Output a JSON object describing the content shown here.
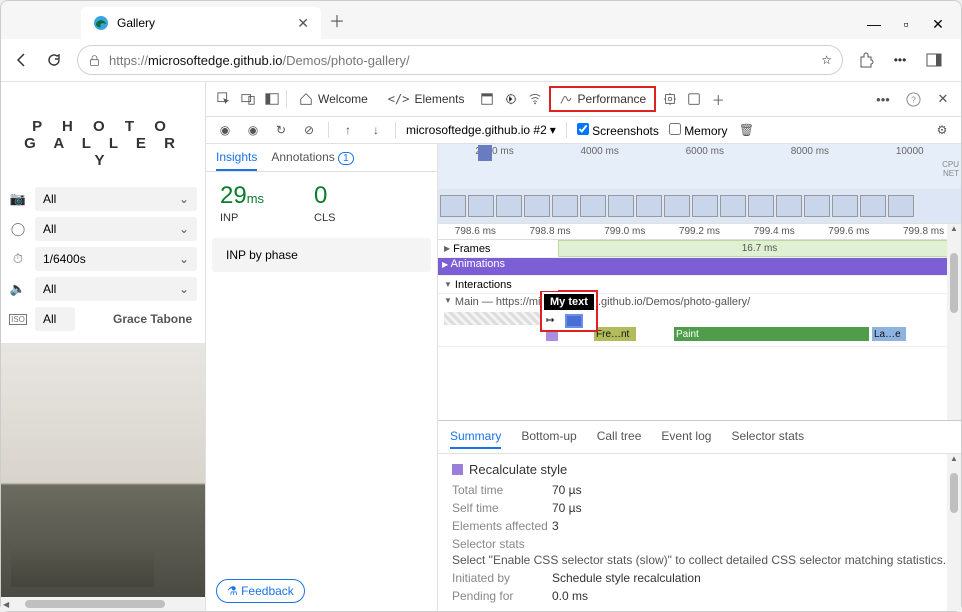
{
  "browser": {
    "tab_title": "Gallery",
    "url_prefix": "https://",
    "url_host": "microsoftedge.github.io",
    "url_path": "/Demos/photo-gallery/"
  },
  "gallery": {
    "logo1": "P H O T O",
    "logo2": "G A L L E R Y",
    "filters": [
      {
        "icon": "camera-icon",
        "value": "All"
      },
      {
        "icon": "aperture-icon",
        "value": "All"
      },
      {
        "icon": "timer-icon",
        "value": "1/6400s"
      },
      {
        "icon": "volume-icon",
        "value": "All"
      },
      {
        "icon": "iso-icon",
        "value": "All"
      }
    ],
    "author": "Grace Tabone"
  },
  "devtools": {
    "tabs": {
      "welcome": "Welcome",
      "elements": "Elements",
      "performance": "Performance"
    },
    "toolbar": {
      "target": "microsoftedge.github.io #2",
      "screenshots_label": "Screenshots",
      "memory_label": "Memory",
      "screenshots_checked": true,
      "memory_checked": false
    },
    "insights": {
      "tab1": "Insights",
      "tab2": "Annotations",
      "anno_count": "1",
      "inp_val": "29",
      "inp_unit": "ms",
      "inp_label": "INP",
      "cls_val": "0",
      "cls_label": "CLS",
      "inp_phase": "INP by phase",
      "feedback": "Feedback"
    },
    "overview": {
      "ticks": [
        "2000 ms",
        "4000 ms",
        "6000 ms",
        "8000 ms",
        "10000"
      ],
      "side": [
        "CPU",
        "NET"
      ]
    },
    "timeline": {
      "ruler": [
        "798.6 ms",
        "798.8 ms",
        "799.0 ms",
        "799.2 ms",
        "799.4 ms",
        "799.6 ms",
        "799.8 ms"
      ],
      "frames_label": "Frames",
      "frames_value": "16.7 ms",
      "animations_label": "Animations",
      "interactions_label": "Interactions",
      "main_label": "Main — https://microsoftedge.github.io/Demos/photo-gallery/",
      "events": {
        "fre": "Fre…nt",
        "paint": "Paint",
        "late": "La…e"
      },
      "annotation_text": "My text"
    },
    "details": {
      "tabs": [
        "Summary",
        "Bottom-up",
        "Call tree",
        "Event log",
        "Selector stats"
      ],
      "title": "Recalculate style",
      "rows": {
        "total_time_k": "Total time",
        "total_time_v": "70 µs",
        "self_time_k": "Self time",
        "self_time_v": "70 µs",
        "elems_k": "Elements affected",
        "elems_v": "3",
        "selstats_k": "Selector stats",
        "selstats_note": "Select \"Enable CSS selector stats (slow)\" to collect detailed CSS selector matching statistics.",
        "initiated_k": "Initiated by",
        "initiated_v": "Schedule style recalculation",
        "pending_k": "Pending for",
        "pending_v": "0.0 ms"
      }
    }
  }
}
